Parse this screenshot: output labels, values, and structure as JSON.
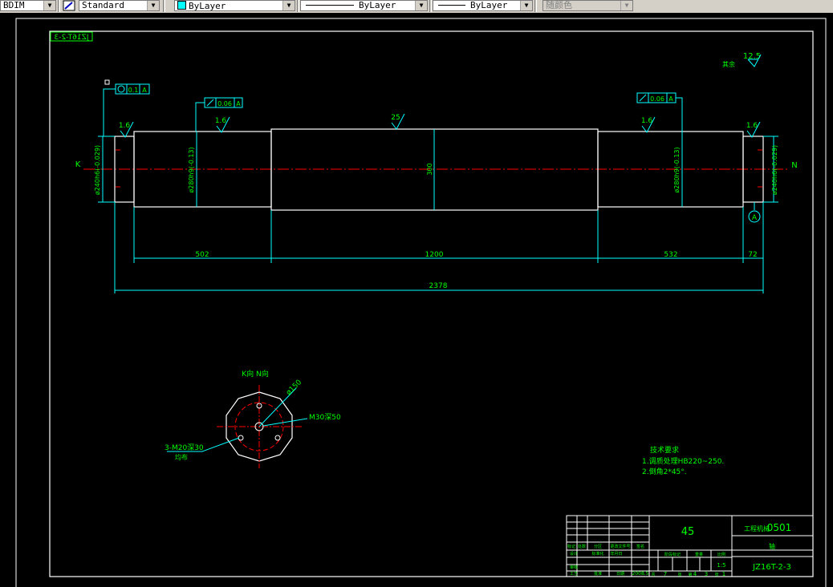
{
  "toolbar": {
    "dimstyle": "BDIM",
    "textstyle": "Standard",
    "layer": "ByLayer",
    "linetype": "ByLayer",
    "lineweight": "ByLayer",
    "plotstyle": "随颜色"
  },
  "drawing": {
    "border_title": "JZ16T-2-3",
    "roughness_general": "12.5",
    "roughness_general_note": "其余",
    "tol_runout_left": "0.1",
    "tol_runout_left_datum": "A",
    "tol_left": "0.06",
    "tol_left_datum": "A",
    "tol_right": "0.06",
    "tol_right_datum": "A",
    "rough_16": "1.6",
    "rough_25": "25",
    "label_k": "K",
    "label_n": "N",
    "datum_a": "A",
    "dia_left_journal": "ø240h6(-0.029)",
    "dia_left_shoulder": "ø280h9(-0.13)",
    "dia_center": "300",
    "dia_right_shoulder": "ø280h9(-0.13)",
    "dia_right_journal": "ø240h6(-0.029)",
    "dim_502": "502",
    "dim_1200": "1200",
    "dim_532": "532",
    "dim_72": "72",
    "dim_2378": "2378",
    "detail_title": "K向 N向",
    "detail_pcd": "ø150",
    "detail_center_hole": "M30深50",
    "detail_holes": "3-M20深30",
    "detail_holes_note": "均布",
    "tech_title": "技术要求",
    "tech_1": "1.调质处理HB220~250.",
    "tech_2": "2.倒角2*45°."
  },
  "titleblock": {
    "material": "45",
    "unit_label": "工程机械",
    "code": "0501",
    "part_name": "轴",
    "drawing_no": "JZ16T-2-3",
    "scale": "1:5",
    "year": "2008.5",
    "left_labels": [
      "标记",
      "处数",
      "分区",
      "更改文件号",
      "签名",
      "年月日",
      "设计",
      "标准化",
      "审核",
      "工艺",
      "批准",
      "日期"
    ],
    "right_labels": [
      "阶段标记",
      "重量",
      "比例",
      "共",
      "张",
      "第",
      "张"
    ],
    "num_7": "7",
    "num_4": "4",
    "num_3": "3",
    "num_1": "1"
  },
  "colors": {
    "outline": "#ffffff",
    "dimension": "#00e5e5",
    "text": "#00ff00",
    "centerline": "#ff0000",
    "border": "#ffffff"
  }
}
